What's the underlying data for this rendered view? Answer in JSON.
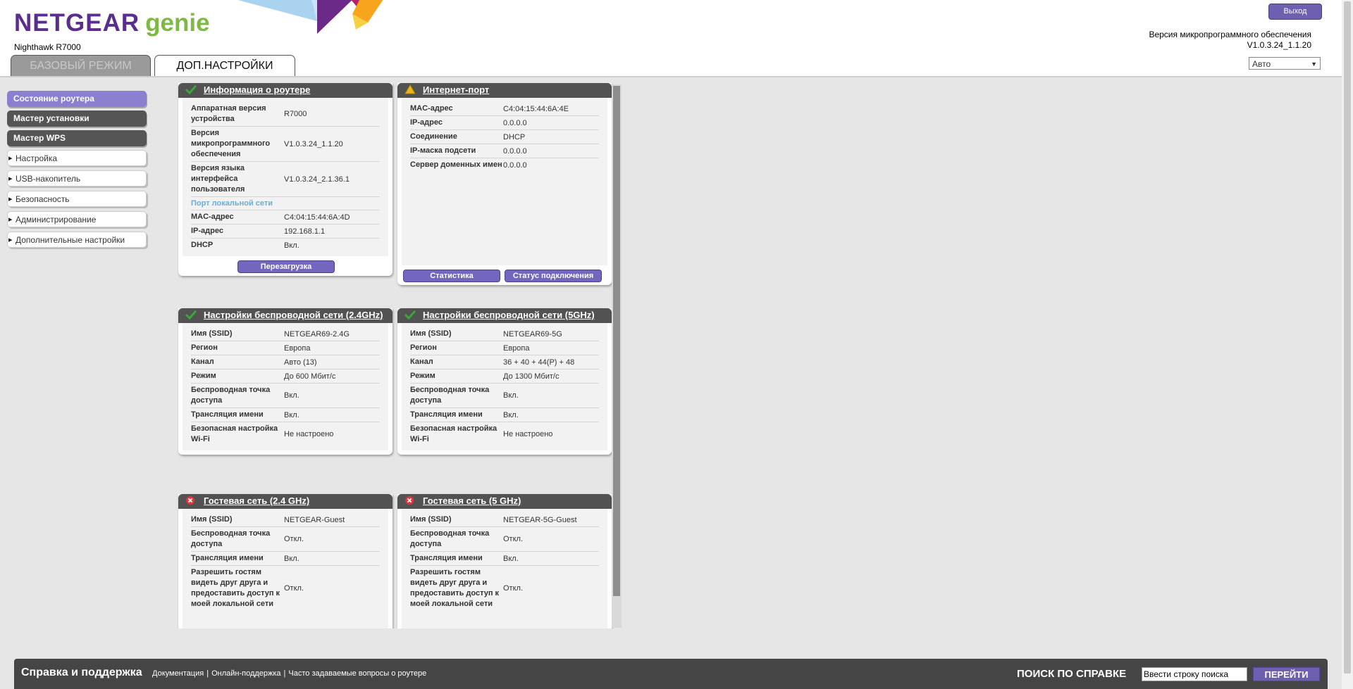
{
  "header": {
    "brand": "NETGEAR",
    "brand_product": "genie",
    "model": "Nighthawk R7000",
    "logout": "Выход",
    "firmware_label": "Версия микропрограммного обеспечения",
    "firmware_version": "V1.0.3.24_1.1.20",
    "language": "Авто",
    "tabs": [
      {
        "label": "БАЗОВЫЙ РЕЖИМ",
        "active": false
      },
      {
        "label": "ДОП.НАСТРОЙКИ",
        "active": true
      }
    ]
  },
  "sidebar": {
    "items": [
      {
        "label": "Состояние роутера"
      },
      {
        "label": "Мастер установки"
      },
      {
        "label": "Мастер WPS"
      },
      {
        "label": "Настройка"
      },
      {
        "label": "USB-накопитель"
      },
      {
        "label": "Безопасность"
      },
      {
        "label": "Администрирование"
      },
      {
        "label": "Дополнительные настройки"
      }
    ]
  },
  "router_info": {
    "title": "Информация о роутере",
    "status": "ok",
    "rows": [
      {
        "k": "Аппаратная версия устройства",
        "v": "R7000"
      },
      {
        "k": "Версия микропрограммного обеспечения",
        "v": "V1.0.3.24_1.1.20"
      },
      {
        "k": "Версия языка интерфейса пользователя",
        "v": "V1.0.3.24_2.1.36.1"
      }
    ],
    "lan_title": "Порт локальной сети",
    "lan_rows": [
      {
        "k": "MAC-адрес",
        "v": "C4:04:15:44:6A:4D"
      },
      {
        "k": "IP-адрес",
        "v": "192.168.1.1"
      },
      {
        "k": "DHCP",
        "v": "Вкл."
      }
    ],
    "button": "Перезагрузка"
  },
  "internet_port": {
    "title": "Интернет-порт",
    "status": "warning",
    "rows": [
      {
        "k": "MAC-адрес",
        "v": "C4:04:15:44:6A:4E"
      },
      {
        "k": "IP-адрес",
        "v": "0.0.0.0"
      },
      {
        "k": "Соединение",
        "v": "DHCP"
      },
      {
        "k": "IP-маска подсети",
        "v": "0.0.0.0"
      },
      {
        "k": "Сервер доменных имен",
        "v": "0.0.0.0"
      }
    ],
    "buttons": [
      "Статистика",
      "Статус подключения"
    ]
  },
  "wifi_24": {
    "title": "Настройки беспроводной сети (2.4GHz)",
    "status": "ok",
    "rows": [
      {
        "k": "Имя (SSID)",
        "v": "NETGEAR69-2.4G"
      },
      {
        "k": "Регион",
        "v": "Европа"
      },
      {
        "k": "Канал",
        "v": "Авто (13)"
      },
      {
        "k": "Режим",
        "v": "До 600 Мбит/с"
      },
      {
        "k": "Беспроводная точка доступа",
        "v": "Вкл."
      },
      {
        "k": "Трансляция имени",
        "v": "Вкл."
      },
      {
        "k": "Безопасная настройка Wi-Fi",
        "v": "Не настроено"
      }
    ]
  },
  "wifi_5": {
    "title": "Настройки беспроводной сети (5GHz)",
    "status": "ok",
    "rows": [
      {
        "k": "Имя (SSID)",
        "v": "NETGEAR69-5G"
      },
      {
        "k": "Регион",
        "v": "Европа"
      },
      {
        "k": "Канал",
        "v": "36 + 40 + 44(P) + 48"
      },
      {
        "k": "Режим",
        "v": "До 1300 Мбит/с"
      },
      {
        "k": "Беспроводная точка доступа",
        "v": "Вкл."
      },
      {
        "k": "Трансляция имени",
        "v": "Вкл."
      },
      {
        "k": "Безопасная настройка Wi-Fi",
        "v": "Не настроено"
      }
    ]
  },
  "guest_24": {
    "title": "Гостевая сеть (2.4 GHz)",
    "status": "error",
    "rows": [
      {
        "k": "Имя (SSID)",
        "v": "NETGEAR-Guest"
      },
      {
        "k": "Беспроводная точка доступа",
        "v": "Откл."
      },
      {
        "k": "Трансляция имени",
        "v": "Вкл."
      },
      {
        "k": "Разрешить гостям видеть друг друга и предоставить доступ к моей локальной сети",
        "v": "Откл."
      }
    ]
  },
  "guest_5": {
    "title": "Гостевая сеть (5 GHz)",
    "status": "error",
    "rows": [
      {
        "k": "Имя (SSID)",
        "v": "NETGEAR-5G-Guest"
      },
      {
        "k": "Беспроводная точка доступа",
        "v": "Откл."
      },
      {
        "k": "Трансляция имени",
        "v": "Вкл."
      },
      {
        "k": "Разрешить гостям видеть друг друга и предоставить доступ к моей локальной сети",
        "v": "Откл."
      }
    ]
  },
  "footer": {
    "help_title": "Справка и поддержка",
    "links": [
      "Документация",
      "Онлайн-поддержка",
      "Часто задаваемые вопросы о роутере"
    ],
    "search_label": "ПОИСК ПО СПРАВКЕ",
    "search_placeholder": "Ввести строку поиска",
    "search_button": "ПЕРЕЙТИ"
  },
  "colors": {
    "accent": "#7366bf",
    "brand_purple": "#5a2d91",
    "brand_green": "#7fb843",
    "panel_header": "#525252",
    "status_ok": "#3aa53a",
    "status_warning": "#e8b818",
    "status_error": "#e0363a"
  }
}
